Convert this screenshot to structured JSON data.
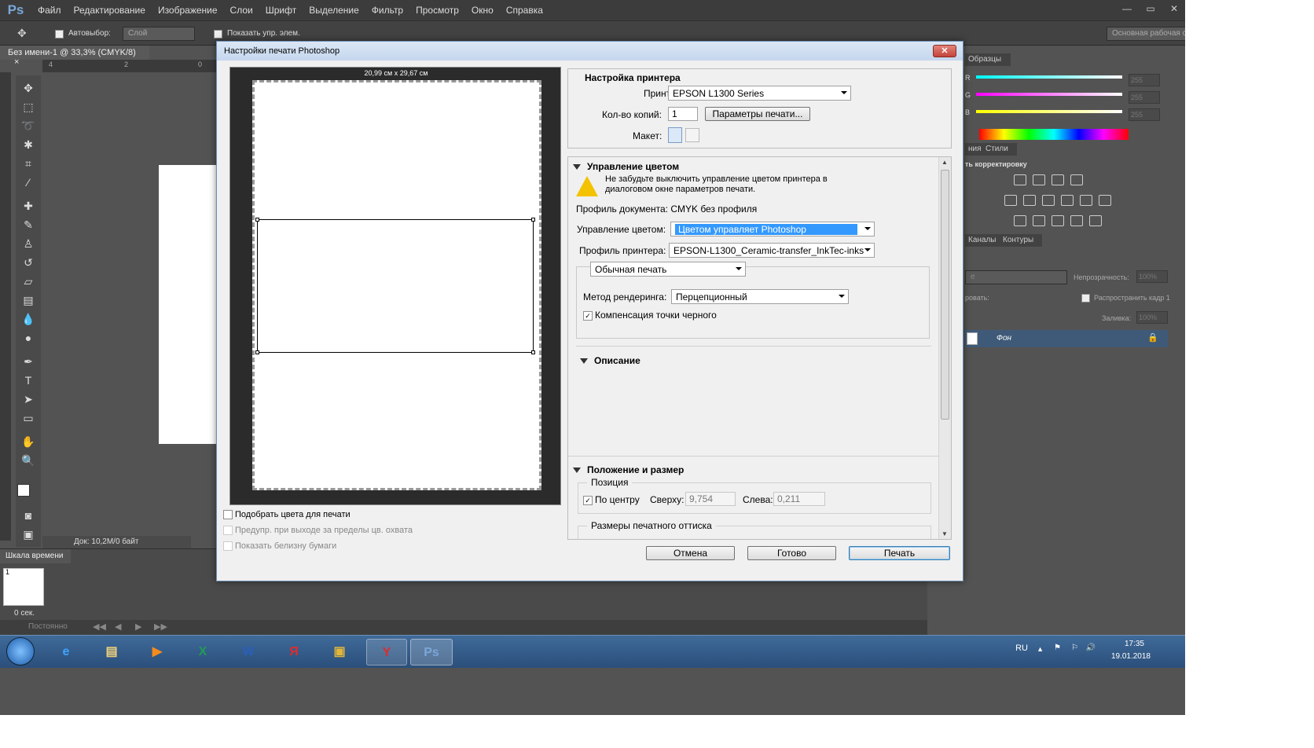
{
  "app": {
    "logo": "Ps",
    "menu": [
      "Файл",
      "Редактирование",
      "Изображение",
      "Слои",
      "Шрифт",
      "Выделение",
      "Фильтр",
      "Просмотр",
      "Окно",
      "Справка"
    ],
    "window_buttons": [
      "—",
      "▭",
      "✕"
    ]
  },
  "options_bar": {
    "autoselect_label": "Автовыбор:",
    "autoselect_value": "Слой",
    "show_transform_label": "Показать упр. элем.",
    "workspace": "Основная рабочая среда"
  },
  "document": {
    "tab_title": "Без имени-1 @ 33,3% (CMYK/8)",
    "tab_close": "×",
    "status": "Док: 10,2M/0 байт",
    "ruler_marks": [
      "4",
      "2",
      "0"
    ]
  },
  "timeline": {
    "tab": "Шкала времени",
    "frame_no": "1",
    "duration": "0 сек.",
    "loop": "Постоянно"
  },
  "right_panel": {
    "swatches_tab": "Образцы",
    "channel_labels": [
      "R",
      "G",
      "B"
    ],
    "channel_values": [
      "255",
      "255",
      "255"
    ],
    "channel_levels": [
      1,
      1,
      1
    ],
    "adjust_tabs": [
      "ния",
      "Стили"
    ],
    "adjust_title": "ть корректировку",
    "layers_tabs": [
      "Каналы",
      "Контуры"
    ],
    "opacity_label": "Непрозрачность:",
    "opacity_value": "100%",
    "lock_label": "ровать:",
    "propagate_label": "Распространить кадр 1",
    "fill_label": "Заливка:",
    "fill_value": "100%",
    "layer_mode": "е",
    "layer_name": "Фон"
  },
  "taskbar": {
    "apps": [
      "e",
      "X",
      "W",
      "Я",
      "Y",
      "Ps"
    ],
    "lang": "RU",
    "time": "17:35",
    "date": "19.01.2018"
  },
  "dialog": {
    "title": "Настройки печати Photoshop",
    "close": "✕",
    "paper_size": "20,99 см x 29,67 см",
    "left_options": [
      {
        "label": "Подобрать цвета для печати",
        "checked": false,
        "enabled": true
      },
      {
        "label": "Предупр. при выходе за пределы цв. охвата",
        "checked": false,
        "enabled": false
      },
      {
        "label": "Показать белизну бумаги",
        "checked": false,
        "enabled": false
      }
    ],
    "printer_setup": {
      "heading": "Настройка принтера",
      "printer_label": "Принтер:",
      "printer_value": "EPSON L1300 Series",
      "copies_label": "Кол-во копий:",
      "copies_value": "1",
      "print_settings_button": "Параметры печати...",
      "layout_label": "Макет:"
    },
    "color_management": {
      "heading": "Управление цветом",
      "warning": "Не забудьте выключить управление цветом принтера в диалоговом окне параметров печати.",
      "doc_profile": "Профиль документа: CMYK без профиля",
      "handling_label": "Управление цветом:",
      "handling_value": "Цветом управляет Photoshop",
      "printer_profile_label": "Профиль принтера:",
      "printer_profile_value": "EPSON-L1300_Ceramic-transfer_InkTec-inks",
      "print_mode": "Обычная печать",
      "rendering_label": "Метод рендеринга:",
      "rendering_value": "Перцепционный",
      "bpc_label": "Компенсация точки черного",
      "bpc_checked": true
    },
    "description": {
      "heading": "Описание"
    },
    "position": {
      "heading": "Положение и размер",
      "group_label": "Позиция",
      "center_label": "По центру",
      "center_checked": true,
      "top_label": "Сверху:",
      "top_value": "9,754",
      "left_label": "Слева:",
      "left_value": "0,211",
      "print_size_label": "Размеры печатного оттиска"
    },
    "buttons": {
      "cancel": "Отмена",
      "done": "Готово",
      "print": "Печать"
    }
  }
}
